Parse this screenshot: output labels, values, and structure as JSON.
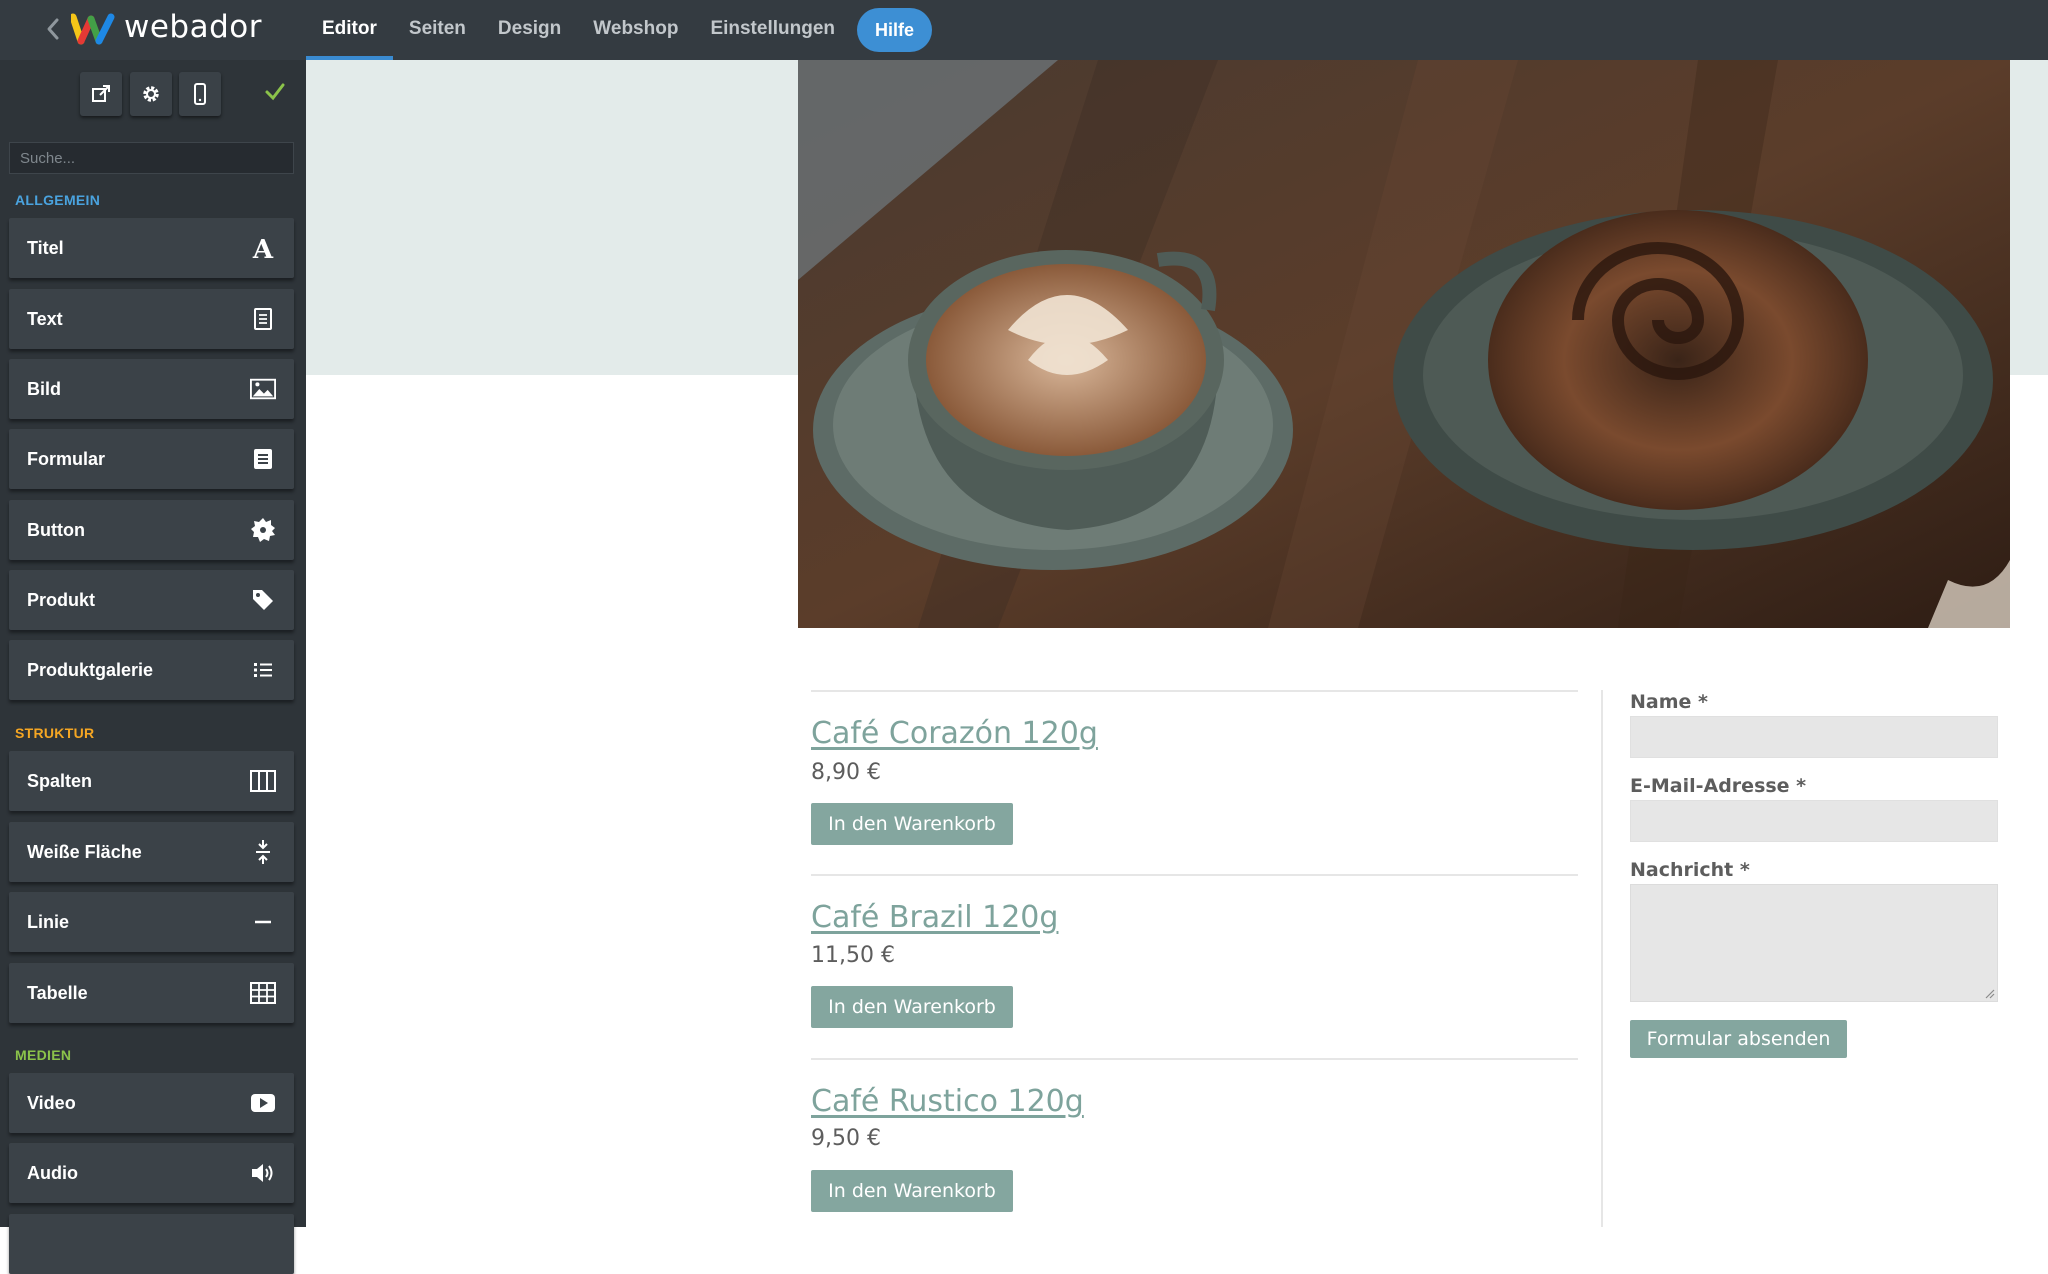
{
  "app": {
    "brand": "webador",
    "logo_colors": [
      "#f5c518",
      "#e53935",
      "#43a047",
      "#1e88e5"
    ]
  },
  "nav": {
    "items": [
      "Editor",
      "Seiten",
      "Design",
      "Webshop",
      "Einstellungen"
    ],
    "active": "Editor",
    "help": "Hilfe"
  },
  "toolbar": {
    "icons": [
      "external-link-icon",
      "gear-icon",
      "mobile-icon",
      "checkmark-icon"
    ],
    "check_color": "#8bc34a"
  },
  "sidebar": {
    "search_placeholder": "Suche...",
    "sections": [
      {
        "heading": "ALLGEMEIN",
        "color": "#4aa3df",
        "items": [
          {
            "label": "Titel",
            "icon": "title-icon"
          },
          {
            "label": "Text",
            "icon": "text-icon"
          },
          {
            "label": "Bild",
            "icon": "image-icon"
          },
          {
            "label": "Formular",
            "icon": "form-icon"
          },
          {
            "label": "Button",
            "icon": "button-icon"
          },
          {
            "label": "Produkt",
            "icon": "tag-icon"
          },
          {
            "label": "Produktgalerie",
            "icon": "list-icon"
          }
        ]
      },
      {
        "heading": "STRUKTUR",
        "color": "#f5a623",
        "items": [
          {
            "label": "Spalten",
            "icon": "columns-icon"
          },
          {
            "label": "Weiße Fläche",
            "icon": "spacing-icon"
          },
          {
            "label": "Linie",
            "icon": "line-icon"
          },
          {
            "label": "Tabelle",
            "icon": "table-icon"
          }
        ]
      },
      {
        "heading": "MEDIEN",
        "color": "#8bc34a",
        "items": [
          {
            "label": "Video",
            "icon": "video-icon"
          },
          {
            "label": "Audio",
            "icon": "audio-icon"
          }
        ]
      }
    ]
  },
  "products": [
    {
      "title": "Café Corazón 120g",
      "price": "8,90 €",
      "button": "In den Warenkorb"
    },
    {
      "title": "Café Brazil 120g",
      "price": "11,50 €",
      "button": "In den Warenkorb"
    },
    {
      "title": "Café Rustico 120g",
      "price": "9,50 €",
      "button": "In den Warenkorb"
    }
  ],
  "form": {
    "name_label": "Name *",
    "email_label": "E-Mail-Adresse *",
    "message_label": "Nachricht *",
    "submit": "Formular absenden"
  },
  "colors": {
    "accent": "#84a69f",
    "topbar": "#343b41",
    "sidebar": "#2e3439",
    "help_button": "#3d8fd4"
  }
}
